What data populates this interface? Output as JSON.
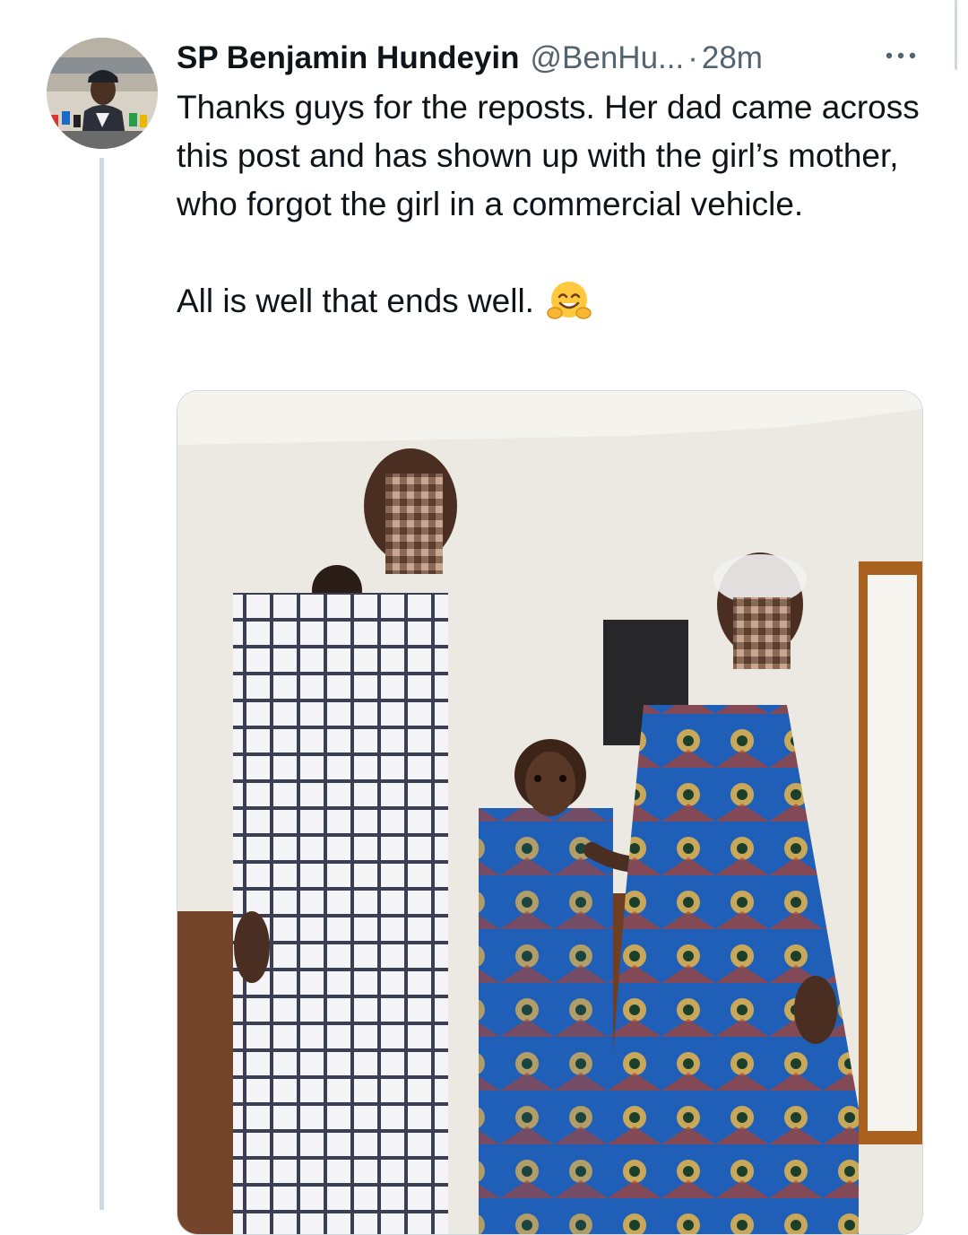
{
  "tweet": {
    "author_name": "SP Benjamin Hundeyin",
    "handle": "@BenHu...",
    "separator": "·",
    "time": "28m",
    "text_lines": [
      "Thanks guys for the reposts. Her dad came across this post and has shown up with the girl’s mother, who forgot the girl in a commercial vehicle.",
      "All is well that ends well."
    ],
    "emoji": "hugging-face-emoji",
    "more_icon": "more-horizontal-icon",
    "avatar_icon": "profile-avatar"
  },
  "colors": {
    "text_primary": "#0f1419",
    "text_secondary": "#536471",
    "thread_line": "#cfd9de",
    "emoji_yellow": "#ffc83d"
  }
}
